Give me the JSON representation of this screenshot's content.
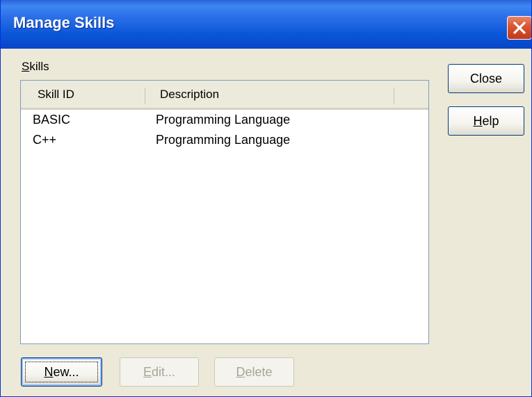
{
  "window": {
    "title": "Manage Skills",
    "close_icon": "close-icon"
  },
  "skills_label": {
    "mnemonic": "S",
    "rest": "kills"
  },
  "list": {
    "columns": [
      "Skill ID",
      "Description"
    ],
    "rows": [
      {
        "skill_id": "BASIC",
        "description": "Programming Language"
      },
      {
        "skill_id": "C++",
        "description": "Programming Language"
      }
    ]
  },
  "buttons": {
    "close": {
      "label": "Close"
    },
    "help": {
      "mnemonic": "H",
      "rest": "elp"
    },
    "new": {
      "mnemonic": "N",
      "rest": "ew..."
    },
    "edit": {
      "mnemonic": "E",
      "rest": "dit..."
    },
    "delete": {
      "mnemonic": "D",
      "rest": "elete"
    }
  },
  "colors": {
    "title_bar": "#0a56d8",
    "close_button": "#d9542e",
    "dialog_background": "#ece9d8"
  }
}
